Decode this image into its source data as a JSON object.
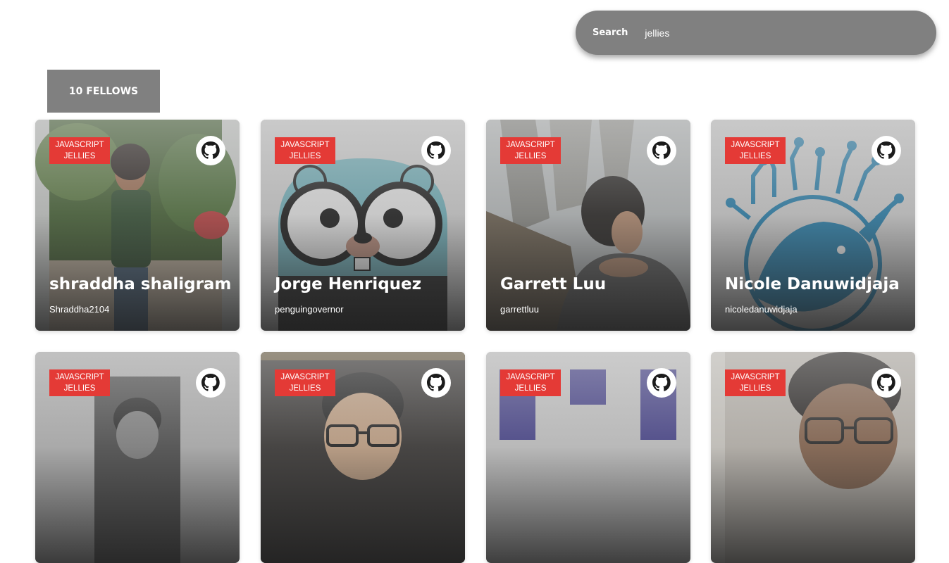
{
  "search": {
    "label": "Search",
    "value": "jellies"
  },
  "summary": {
    "count_label": "10 FELLOWS"
  },
  "tag": {
    "line1": "JAVASCRIPT",
    "line2": "JELLIES"
  },
  "cards": [
    {
      "name": "shraddha shaligram",
      "handle": "Shraddha2104"
    },
    {
      "name": "Jorge Henriquez",
      "handle": "penguingovernor"
    },
    {
      "name": "Garrett Luu",
      "handle": "garrettluu"
    },
    {
      "name": "Nicole Danuwidjaja",
      "handle": "nicoledanuwidjaja"
    },
    {
      "name": "",
      "handle": ""
    },
    {
      "name": "",
      "handle": ""
    },
    {
      "name": "",
      "handle": ""
    },
    {
      "name": "",
      "handle": ""
    }
  ],
  "colors": {
    "tag": "#e43a36",
    "panel": "#808080"
  }
}
